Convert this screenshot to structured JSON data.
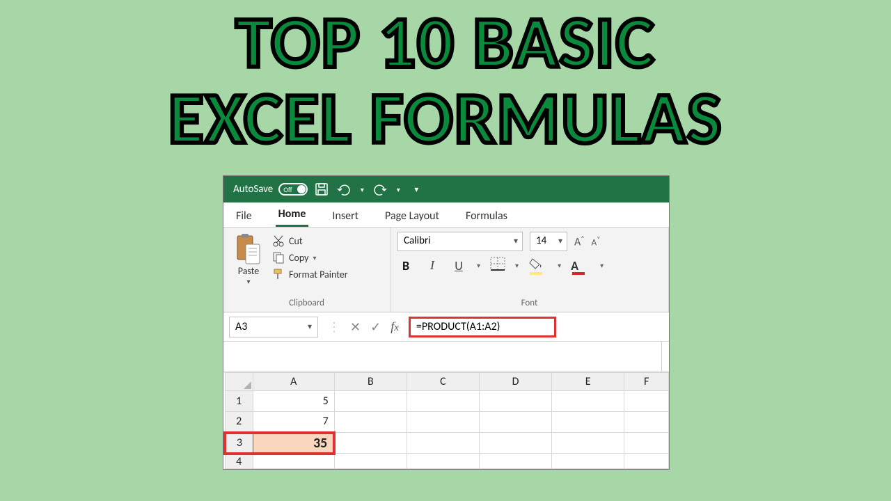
{
  "headline": {
    "line1": "TOP 10 BASIC",
    "line2": "EXCEL FORMULAS"
  },
  "titlebar": {
    "autosave_label": "AutoSave",
    "toggle_state": "Off"
  },
  "tabs": {
    "file": "File",
    "home": "Home",
    "insert": "Insert",
    "page_layout": "Page Layout",
    "formulas": "Formulas"
  },
  "ribbon": {
    "clipboard": {
      "paste": "Paste",
      "cut": "Cut",
      "copy": "Copy",
      "format_painter": "Format Painter",
      "group_label": "Clipboard"
    },
    "font": {
      "name": "Calibri",
      "size": "14",
      "group_label": "Font"
    }
  },
  "formula_bar": {
    "name_box": "A3",
    "formula": "=PRODUCT(A1:A2)"
  },
  "grid": {
    "columns": [
      "A",
      "B",
      "C",
      "D",
      "E",
      "F"
    ],
    "rows": [
      {
        "num": "1",
        "A": "5"
      },
      {
        "num": "2",
        "A": "7"
      },
      {
        "num": "3",
        "A": "35"
      },
      {
        "num": "4",
        "A": ""
      }
    ]
  }
}
